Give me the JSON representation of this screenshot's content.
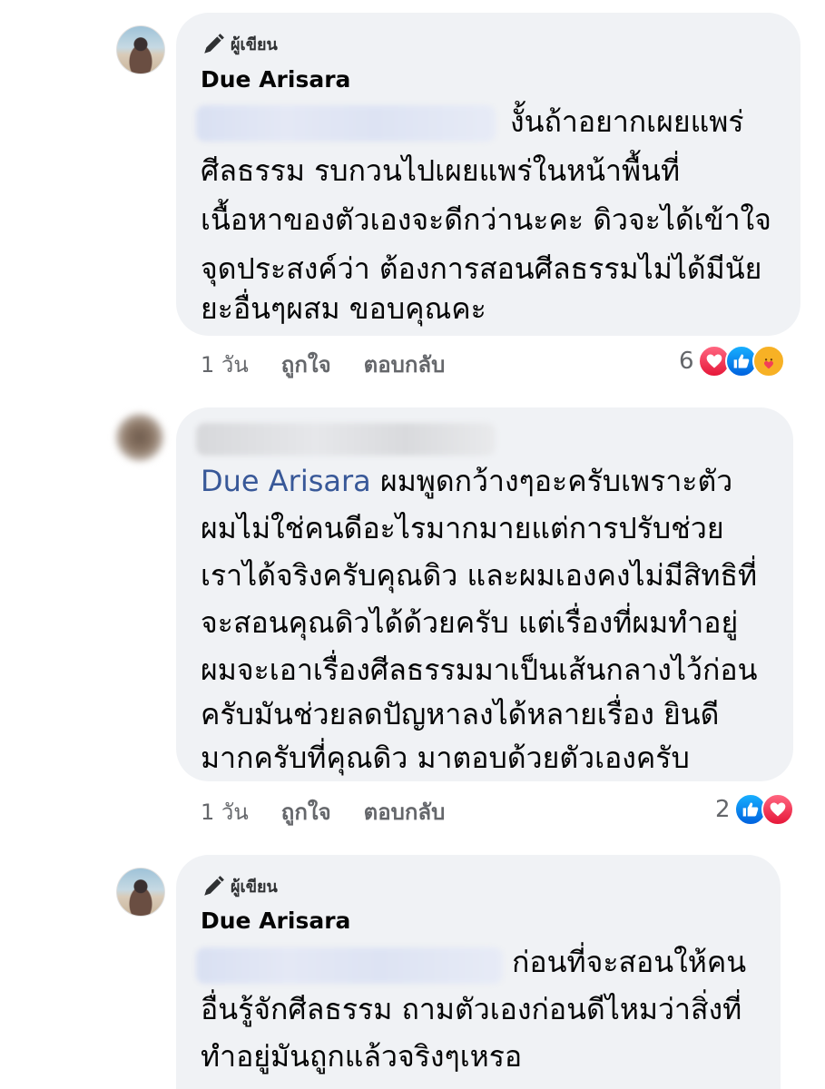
{
  "comments": [
    {
      "badge": "ผู้เขียน",
      "author": "Due Arisara",
      "lines": [
        "งั้นถ้าอยากเผยแพร่",
        "ศีลธรรม รบกวนไปเผยแพร่ในหน้าพื้นที่",
        "เนื้อหาของตัวเองจะดีกว่านะคะ ดิวจะได้เข้าใจ",
        "จุดประสงค์ว่า ต้องการสอนศีลธรรมไม่ได้มีนัย",
        "ยะอื่นๆผสม ขอบคุณคะ"
      ],
      "time": "1 วัน",
      "like_label": "ถูกใจ",
      "reply_label": "ตอบกลับ",
      "reaction_count": "6",
      "reactions": [
        "love-icon",
        "like-icon",
        "care-icon"
      ]
    },
    {
      "mention": "Due Arisara",
      "lines": [
        "ผมพูดกว้างๆอะครับเพราะตัว",
        "ผมไม่ใช่คนดีอะไรมากมายแต่การปรับช่วย",
        "เราได้จริงครับคุณดิว และผมเองคงไม่มีสิทธิที่",
        "จะสอนคุณดิวได้ด้วยครับ แต่เรื่องที่ผมทำอยู่",
        "ผมจะเอาเรื่องศีลธรรมมาเป็นเส้นกลางไว้ก่อน",
        "ครับมันช่วยลดปัญหาลงได้หลายเรื่อง ยินดี",
        "มากครับที่คุณดิว มาตอบด้วยตัวเองครับ"
      ],
      "time": "1 วัน",
      "like_label": "ถูกใจ",
      "reply_label": "ตอบกลับ",
      "reaction_count": "2",
      "reactions": [
        "like-icon",
        "love-icon"
      ]
    },
    {
      "badge": "ผู้เขียน",
      "author": "Due Arisara",
      "lines": [
        "ก่อนที่จะสอนให้คน",
        "อื่นรู้จักศีลธรรม ถามตัวเองก่อนดีไหมว่าสิ่งที่",
        "ทำอยู่มันถูกแล้วจริงๆเหรอ"
      ]
    }
  ],
  "colors": {
    "bubble": "#f0f2f5",
    "mention": "#385898",
    "meta": "#65676b",
    "like": "#1877f2",
    "love": "#f33e58"
  }
}
